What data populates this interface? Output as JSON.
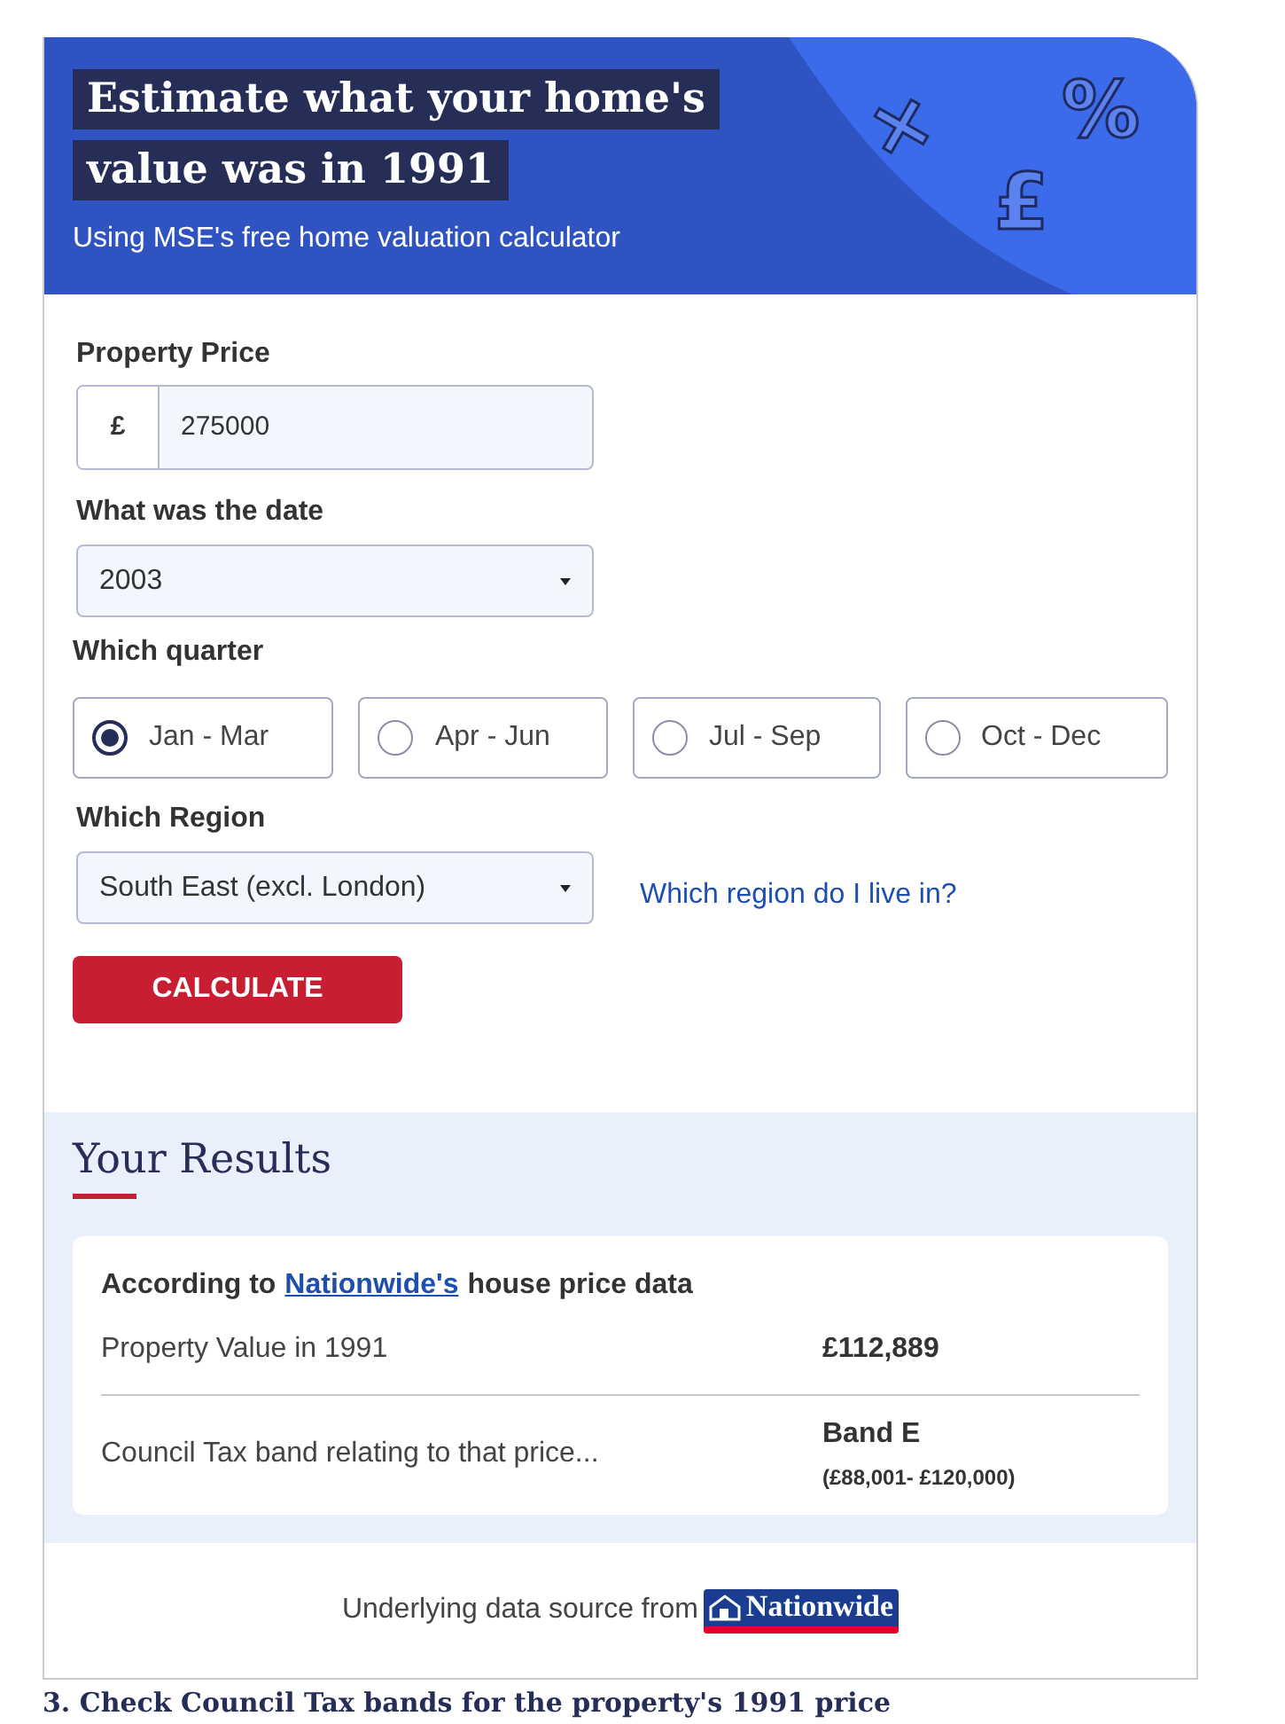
{
  "header": {
    "title_lines": [
      "Estimate what your home's",
      "value was in 1991"
    ],
    "subtitle": "Using MSE's free home valuation calculator",
    "symbols": [
      "×",
      "%",
      "£"
    ]
  },
  "form": {
    "price_label": "Property Price",
    "currency": "£",
    "price_value": "275000",
    "date_label": "What was the date",
    "date_value": "2003",
    "quarter_label": "Which quarter",
    "quarters": [
      {
        "label": "Jan - Mar",
        "selected": true
      },
      {
        "label": "Apr - Jun",
        "selected": false
      },
      {
        "label": "Jul - Sep",
        "selected": false
      },
      {
        "label": "Oct - Dec",
        "selected": false
      }
    ],
    "region_label": "Which Region",
    "region_value": "South East (excl. London)",
    "region_link": "Which region do I live in?",
    "calculate_button": "CALCULATE"
  },
  "results": {
    "heading": "Your Results",
    "source_prefix": "According to",
    "source_link": "Nationwide's",
    "source_suffix": "house price data",
    "rows": [
      {
        "label": "Property Value in 1991",
        "value": "£112,889"
      },
      {
        "label": "Council Tax band relating to that price...",
        "value": "Band E",
        "note": "(£88,001- £120,000)"
      }
    ]
  },
  "footer": {
    "text": "Underlying data source from",
    "logo_text": "Nationwide"
  },
  "next_heading": "3. Check Council Tax bands for the property's 1991 price"
}
